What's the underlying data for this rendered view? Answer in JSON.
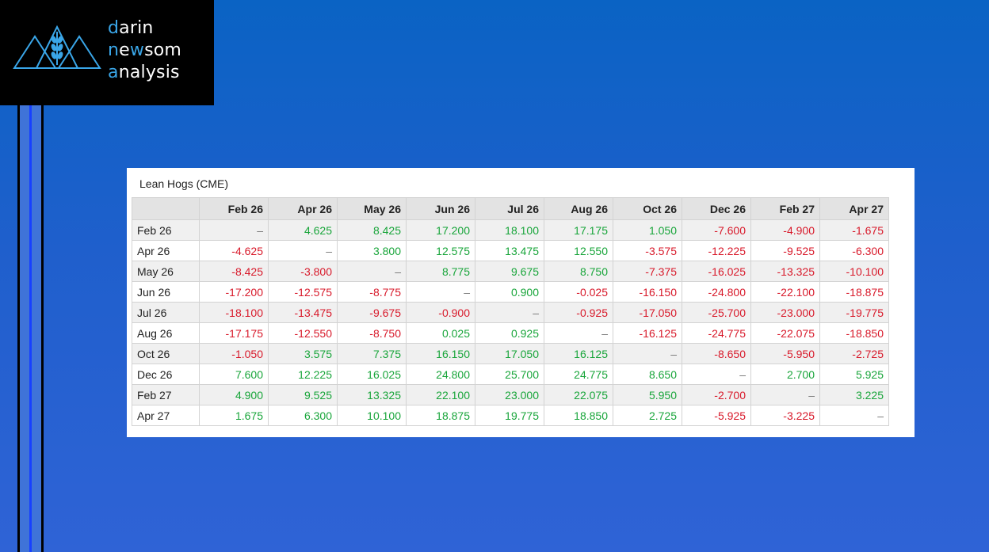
{
  "logo": {
    "line1": {
      "accent": "d",
      "rest": "arin"
    },
    "line2": {
      "p1": "n",
      "p2": "e",
      "p3": "w",
      "p4": "som"
    },
    "line3": {
      "accent": "a",
      "rest": "nalysis"
    },
    "accent_color": "#3aa6e8",
    "icon": "mountains-wheat-icon"
  },
  "panel": {
    "title": "Lean Hogs (CME)",
    "columns": [
      "Feb 26",
      "Apr 26",
      "May 26",
      "Jun 26",
      "Jul 26",
      "Aug 26",
      "Oct 26",
      "Dec 26",
      "Feb 27",
      "Apr 27"
    ],
    "rows": [
      {
        "label": "Feb 26",
        "values": [
          "–",
          "4.625",
          "8.425",
          "17.200",
          "18.100",
          "17.175",
          "1.050",
          "-7.600",
          "-4.900",
          "-1.675"
        ]
      },
      {
        "label": "Apr 26",
        "values": [
          "-4.625",
          "–",
          "3.800",
          "12.575",
          "13.475",
          "12.550",
          "-3.575",
          "-12.225",
          "-9.525",
          "-6.300"
        ]
      },
      {
        "label": "May 26",
        "values": [
          "-8.425",
          "-3.800",
          "–",
          "8.775",
          "9.675",
          "8.750",
          "-7.375",
          "-16.025",
          "-13.325",
          "-10.100"
        ]
      },
      {
        "label": "Jun 26",
        "values": [
          "-17.200",
          "-12.575",
          "-8.775",
          "–",
          "0.900",
          "-0.025",
          "-16.150",
          "-24.800",
          "-22.100",
          "-18.875"
        ]
      },
      {
        "label": "Jul 26",
        "values": [
          "-18.100",
          "-13.475",
          "-9.675",
          "-0.900",
          "–",
          "-0.925",
          "-17.050",
          "-25.700",
          "-23.000",
          "-19.775"
        ]
      },
      {
        "label": "Aug 26",
        "values": [
          "-17.175",
          "-12.550",
          "-8.750",
          "0.025",
          "0.925",
          "–",
          "-16.125",
          "-24.775",
          "-22.075",
          "-18.850"
        ]
      },
      {
        "label": "Oct 26",
        "values": [
          "-1.050",
          "3.575",
          "7.375",
          "16.150",
          "17.050",
          "16.125",
          "–",
          "-8.650",
          "-5.950",
          "-2.725"
        ]
      },
      {
        "label": "Dec 26",
        "values": [
          "7.600",
          "12.225",
          "16.025",
          "24.800",
          "25.700",
          "24.775",
          "8.650",
          "–",
          "2.700",
          "5.925"
        ]
      },
      {
        "label": "Feb 27",
        "values": [
          "4.900",
          "9.525",
          "13.325",
          "22.100",
          "23.000",
          "22.075",
          "5.950",
          "-2.700",
          "–",
          "3.225"
        ]
      },
      {
        "label": "Apr 27",
        "values": [
          "1.675",
          "6.300",
          "10.100",
          "18.875",
          "19.775",
          "18.850",
          "2.725",
          "-5.925",
          "-3.225",
          "–"
        ]
      }
    ],
    "colors": {
      "positive": "#18a53a",
      "negative": "#d8192a",
      "header_bg": "#e3e3e3"
    }
  }
}
